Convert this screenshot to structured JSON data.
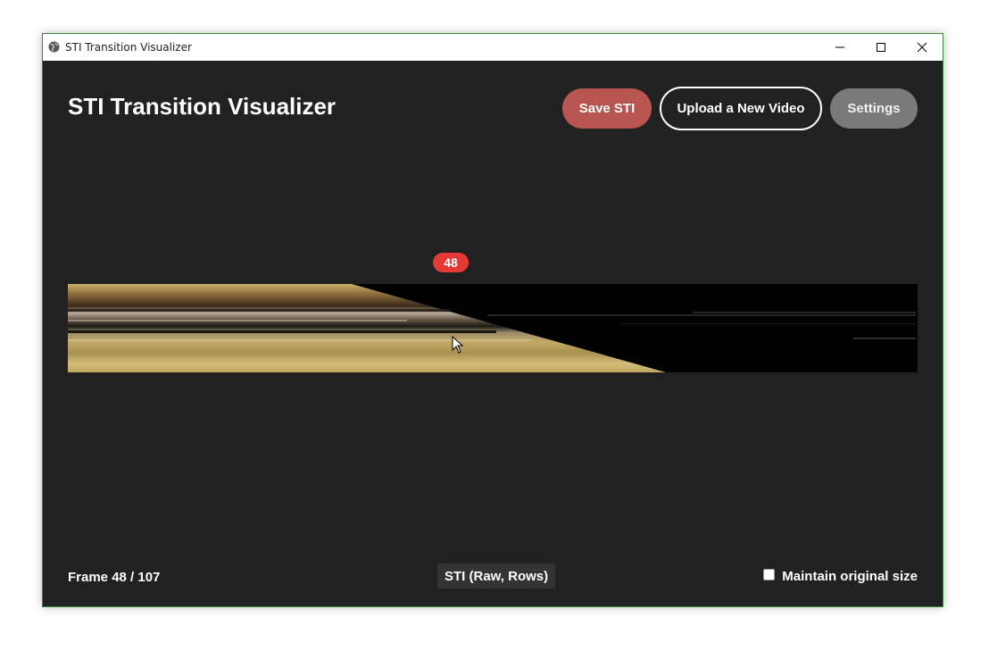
{
  "window": {
    "title": "STI Transition Visualizer",
    "controls": [
      "minimize-icon",
      "maximize-icon",
      "close-icon"
    ]
  },
  "header": {
    "title": "STI Transition Visualizer",
    "buttons": {
      "save": "Save STI",
      "upload": "Upload a New Video",
      "settings": "Settings"
    }
  },
  "viewer": {
    "frame_marker": "48",
    "image": "sti-spatiotemporal-image"
  },
  "footer": {
    "frame_counter": "Frame 48 / 107",
    "mode_label": "STI (Raw, Rows)",
    "maintain_label": "Maintain original size",
    "maintain_checked": false
  },
  "colors": {
    "background": "#212121",
    "save_button": "#b85550",
    "settings_button": "#7a7a7a",
    "marker": "#e53935",
    "accent_gold": "#c9b06a"
  }
}
